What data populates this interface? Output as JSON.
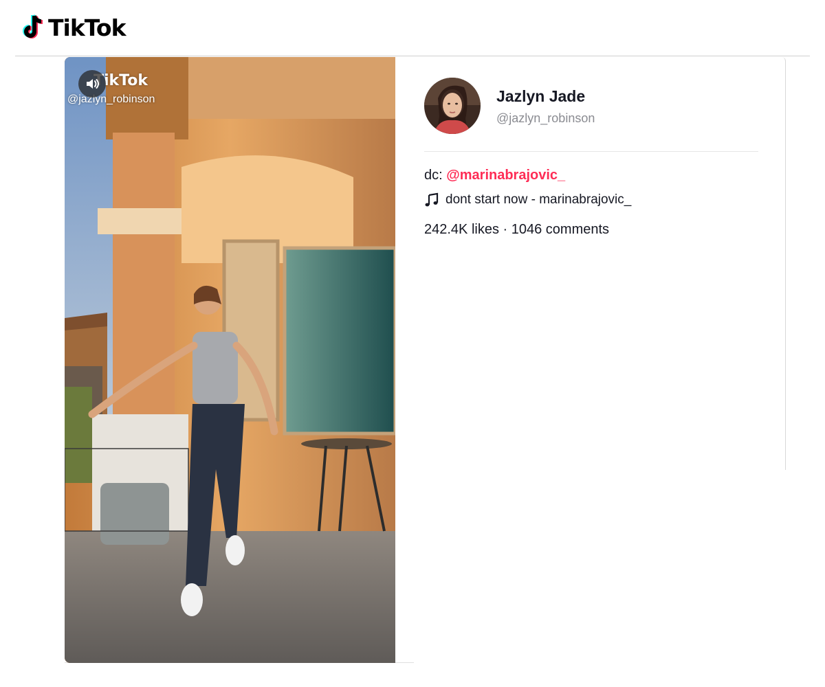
{
  "header": {
    "logo_text": "TikTok"
  },
  "video": {
    "watermark_logo": "TikTok",
    "watermark_handle": "@jazlyn_robinson",
    "mute_icon": "speaker-icon"
  },
  "author": {
    "name": "Jazlyn Jade",
    "handle": "@jazlyn_robinson"
  },
  "caption": {
    "prefix": "dc: ",
    "mention": "@marinabrajovic_"
  },
  "music": {
    "icon": "music-note-icon",
    "title": "dont start now - marinabrajovic_"
  },
  "stats": {
    "likes": "242.4K likes",
    "separator": " · ",
    "comments": "1046 comments"
  },
  "colors": {
    "brand_pink": "#fe2c55",
    "brand_cyan": "#25f4ee",
    "text": "#161823",
    "muted": "#8a8b91"
  }
}
